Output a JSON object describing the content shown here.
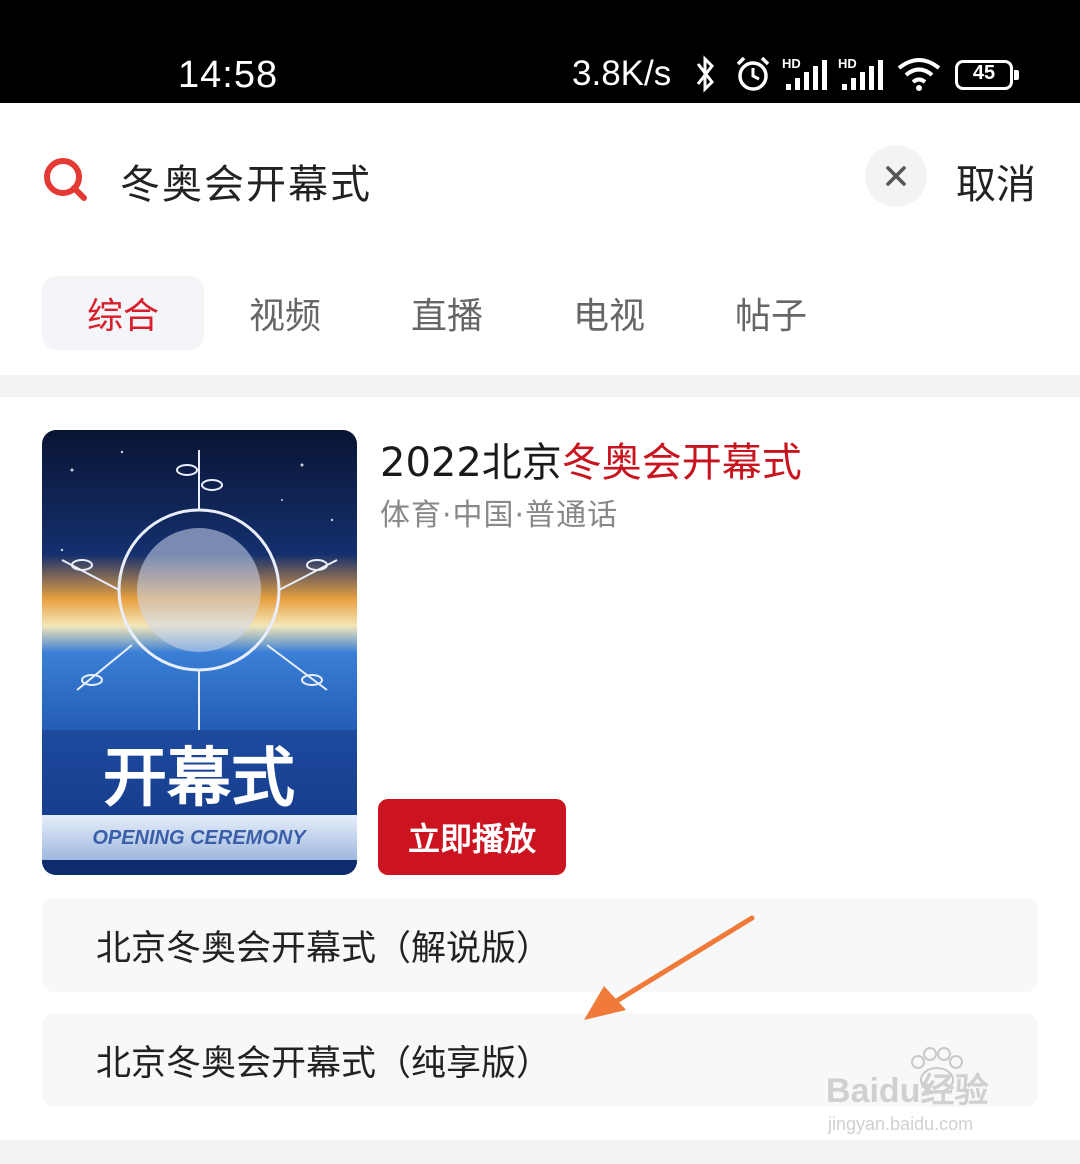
{
  "status_bar": {
    "time": "14:58",
    "net_speed": "3.8K/s",
    "battery": "45",
    "icons": [
      "bluetooth-icon",
      "alarm-icon",
      "hd-signal-icon",
      "hd-signal-icon",
      "wifi-icon",
      "battery-icon"
    ]
  },
  "search": {
    "query": "冬奥会开幕式",
    "cancel_label": "取消",
    "accent": "#e53935"
  },
  "tabs": [
    {
      "label": "综合",
      "active": true
    },
    {
      "label": "视频",
      "active": false
    },
    {
      "label": "直播",
      "active": false
    },
    {
      "label": "电视",
      "active": false
    },
    {
      "label": "帖子",
      "active": false
    }
  ],
  "result": {
    "title_prefix": "2022北京",
    "title_highlight": "冬奥会开幕式",
    "meta": "体育·中国·普通话",
    "poster_title": "开幕式",
    "poster_subtitle": "OPENING CEREMONY",
    "play_label": "立即播放",
    "versions": [
      "北京冬奥会开幕式（解说版）",
      "北京冬奥会开幕式（纯享版）"
    ]
  },
  "watermark": {
    "brand": "Baidu经验",
    "url": "jingyan.baidu.com"
  },
  "colors": {
    "brand_red": "#cc1420",
    "highlight_red": "#c8141e",
    "arrow_orange": "#f07a3a"
  }
}
